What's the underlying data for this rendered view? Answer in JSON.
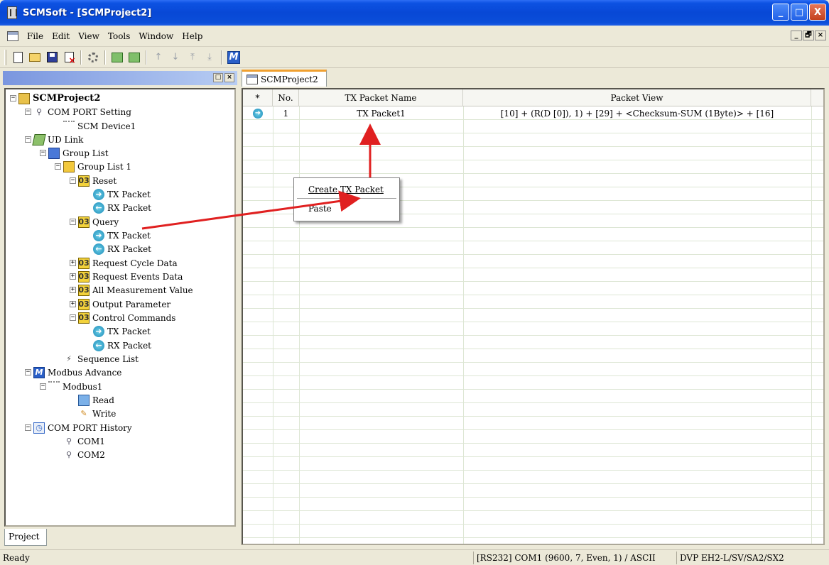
{
  "window": {
    "title": "SCMSoft - [SCMProject2]",
    "min": "_",
    "max": "□",
    "close": "X"
  },
  "menu": {
    "items": [
      "File",
      "Edit",
      "View",
      "Tools",
      "Window",
      "Help"
    ],
    "mdi_buttons": [
      "_",
      "🗗",
      "×"
    ]
  },
  "left_panel": {
    "dock_buttons": [
      "□",
      "×"
    ],
    "tab": "Project",
    "tree": [
      {
        "label": "SCMProject2",
        "bold": true,
        "icon": "project-icon"
      },
      {
        "label": "COM PORT Setting",
        "icon": "com-port-icon"
      },
      {
        "label": "SCM Device1",
        "icon": "device-icon"
      },
      {
        "label": "UD Link",
        "icon": "link-icon"
      },
      {
        "label": "Group List",
        "icon": "group-list-icon"
      },
      {
        "label": "Group List 1",
        "icon": "group-icon"
      },
      {
        "label": "Reset",
        "icon": "command-icon"
      },
      {
        "label": "TX Packet",
        "icon": "tx-packet-icon"
      },
      {
        "label": "RX Packet",
        "icon": "rx-packet-icon"
      },
      {
        "label": "Query",
        "icon": "command-icon"
      },
      {
        "label": "TX Packet",
        "icon": "tx-packet-icon"
      },
      {
        "label": "RX Packet",
        "icon": "rx-packet-icon"
      },
      {
        "label": "Request Cycle Data",
        "icon": "command-icon"
      },
      {
        "label": "Request Events Data",
        "icon": "command-icon"
      },
      {
        "label": "All Measurement Value",
        "icon": "command-icon"
      },
      {
        "label": "Output Parameter",
        "icon": "command-icon"
      },
      {
        "label": "Control Commands",
        "icon": "command-icon"
      },
      {
        "label": "TX Packet",
        "icon": "tx-packet-icon"
      },
      {
        "label": "RX Packet",
        "icon": "rx-packet-icon"
      },
      {
        "label": "Sequence List",
        "icon": "sequence-icon"
      },
      {
        "label": "Modbus Advance",
        "icon": "modbus-icon"
      },
      {
        "label": "Modbus1",
        "icon": "device-icon"
      },
      {
        "label": "Read",
        "icon": "read-icon"
      },
      {
        "label": "Write",
        "icon": "write-icon"
      },
      {
        "label": "COM PORT History",
        "icon": "history-icon"
      },
      {
        "label": "COM1",
        "icon": "com-port-icon"
      },
      {
        "label": "COM2",
        "icon": "com-port-icon"
      }
    ]
  },
  "document": {
    "tab": "SCMProject2",
    "columns": [
      "*",
      "No.",
      "TX Packet Name",
      "Packet View"
    ],
    "rows": [
      {
        "no": "1",
        "name": "TX Packet1",
        "view": "[10] + (R(D [0]), 1) + [29] + <Checksum-SUM (1Byte)> + [16]"
      }
    ]
  },
  "context_menu": {
    "create": "Create TX Packet",
    "paste": "Paste"
  },
  "status": {
    "left": "Ready",
    "port": "[RS232] COM1 (9600, 7, Even, 1) / ASCII",
    "device": "DVP EH2-L/SV/SA2/SX2"
  },
  "colors": {
    "title_bar": "#0a4ed9",
    "arrow": "#e02020",
    "tab_accent": "#f0a030"
  }
}
